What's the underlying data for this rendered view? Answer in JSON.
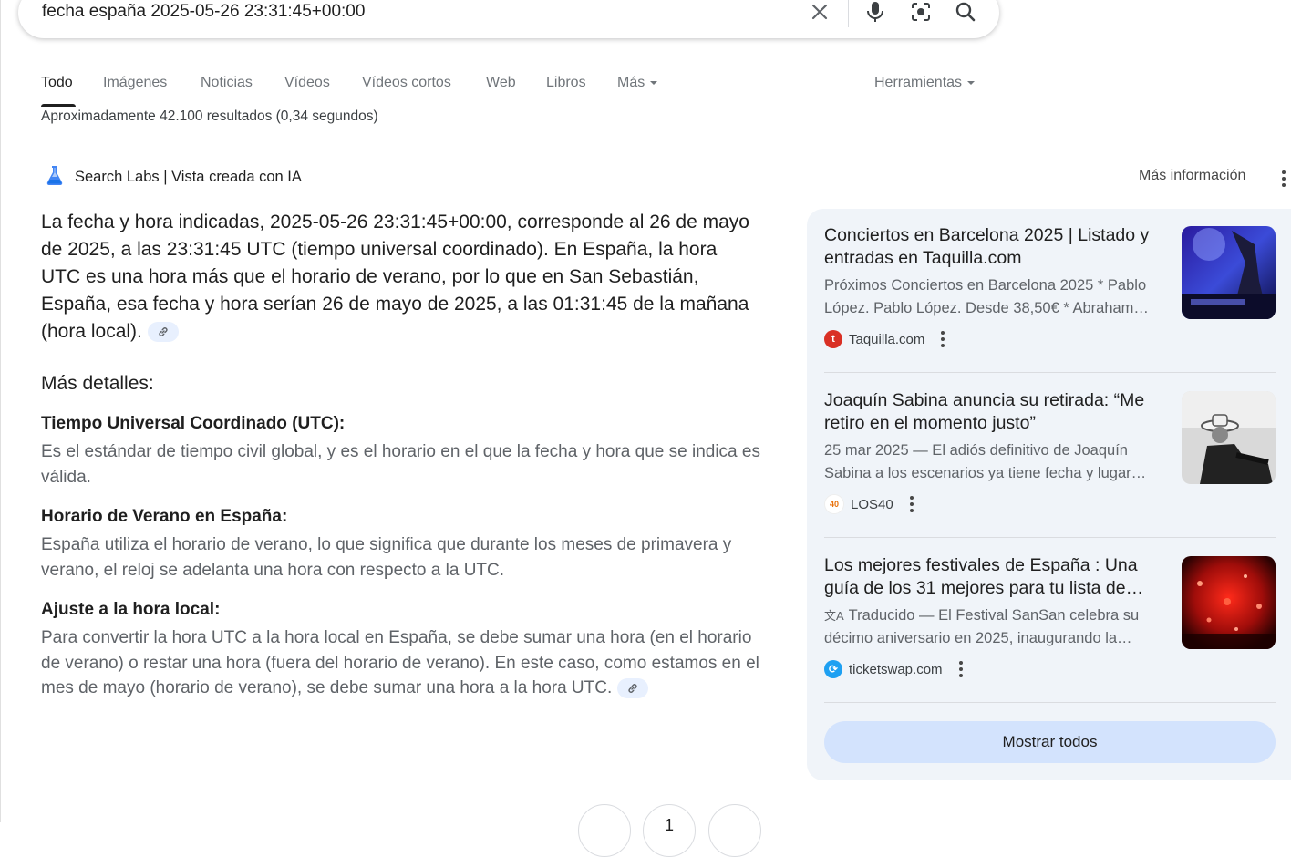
{
  "search": {
    "query": "fecha españa 2025-05-26 23:31:45+00:00"
  },
  "tabs": [
    {
      "label": "Todo"
    },
    {
      "label": "Imágenes"
    },
    {
      "label": "Noticias"
    },
    {
      "label": "Vídeos"
    },
    {
      "label": "Vídeos cortos"
    },
    {
      "label": "Web"
    },
    {
      "label": "Libros"
    },
    {
      "label": "Más"
    }
  ],
  "tools_label": "Herramientas",
  "result_stats": "Aproximadamente 42.100 resultados (0,34 segundos)",
  "ai_overview": {
    "title": "Search Labs | Vista creada con IA",
    "more_info": "Más información",
    "lead": "La fecha y hora indicadas, 2025-05-26 23:31:45+00:00, corresponde al 26 de mayo de 2025, a las 23:31:45 UTC (tiempo universal coordinado). En España, la hora UTC es una hora más que el horario de verano, por lo que en San Sebastián, España, esa fecha y hora serían 26 de mayo de 2025, a las 01:31:45 de la mañana (hora local).",
    "details_heading": "Más detalles:",
    "details": [
      {
        "title": "Tiempo Universal Coordinado (UTC):",
        "text": "Es el estándar de tiempo civil global, y es el horario en el que la fecha y hora que se indica es válida."
      },
      {
        "title": "Horario de Verano en España:",
        "text": "España utiliza el horario de verano, lo que significa que durante los meses de primavera y verano, el reloj se adelanta una hora con respecto a la UTC."
      },
      {
        "title": "Ajuste a la hora local:",
        "text": "Para convertir la hora UTC a la hora local en España, se debe sumar una hora (en el horario de verano) o restar una hora (fuera del horario de verano). En este caso, como estamos en el mes de mayo (horario de verano), se debe sumar una hora a la hora UTC."
      }
    ]
  },
  "sources": [
    {
      "title": "Conciertos en Barcelona 2025 | Listado y entradas en Taquilla.com",
      "snippet_line1": "Próximos Conciertos en Barcelona 2025 * Pablo",
      "snippet_line2": "López. Pablo López. Desde 38,50€ * Abraham…",
      "source": "Taquilla.com",
      "favicon_color": "#d93025",
      "favicon_text": "t"
    },
    {
      "title": "Joaquín Sabina anuncia su retirada: “Me retiro en el momento justo”",
      "snippet_line1": "25 mar 2025 — El adiós definitivo de Joaquín",
      "snippet_line2": "Sabina a los escenarios ya tiene fecha y lugar…",
      "source": "LOS40",
      "favicon_color": "#ffffff",
      "favicon_text": "40"
    },
    {
      "title": "Los mejores festivales de España : Una guía de los 31 mejores para tu lista de…",
      "translated_icon": "文A",
      "snippet_line1": "Traducido — El Festival SanSan celebra su",
      "snippet_line2": "décimo aniversario en 2025, inaugurando la…",
      "source": "ticketswap.com",
      "favicon_color": "#1ea0f2",
      "favicon_text": "⟳"
    }
  ],
  "show_all_label": "Mostrar todos",
  "pager": {
    "current": "1"
  }
}
